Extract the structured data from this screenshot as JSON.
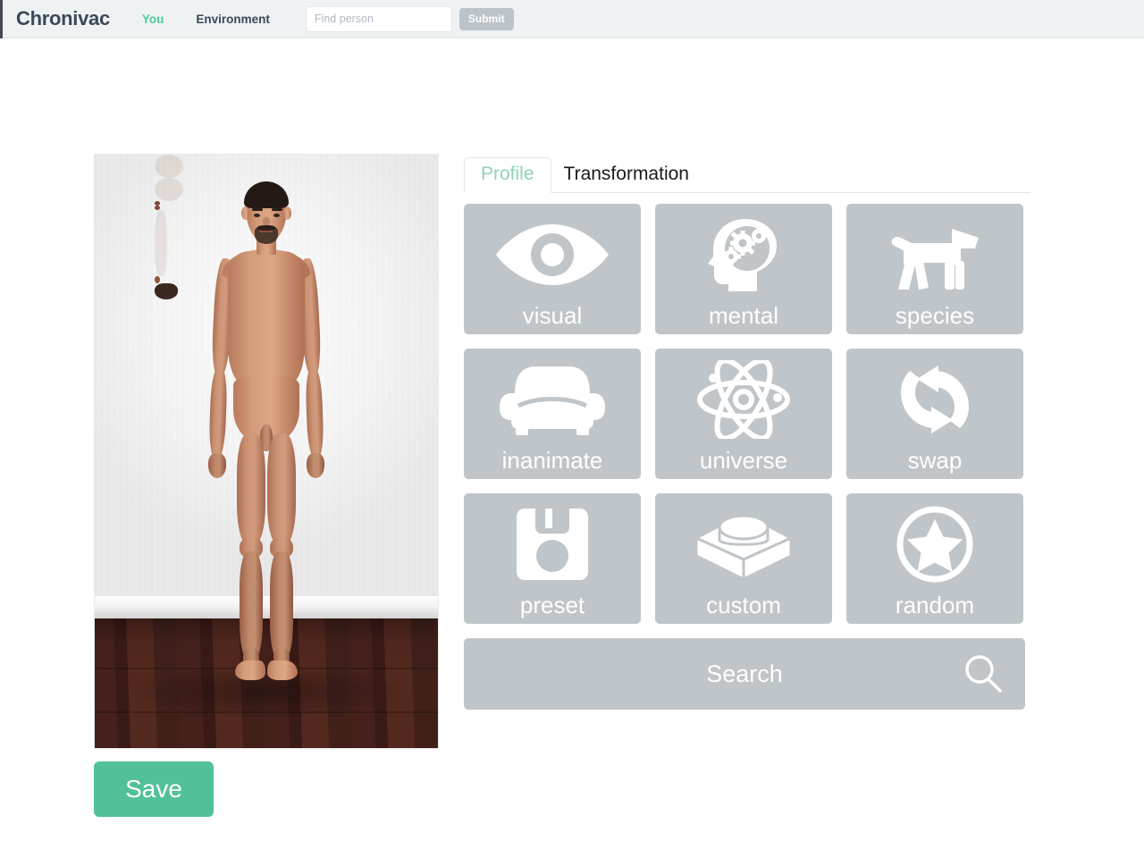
{
  "navbar": {
    "brand": "Chronivac",
    "links": [
      {
        "label": "You",
        "state": "active"
      },
      {
        "label": "Environment",
        "state": "default"
      }
    ],
    "search": {
      "value": "",
      "placeholder": "Find person"
    },
    "submit_label": "Submit",
    "colors": {
      "background": "#eef2f3",
      "brand_text": "#3c4858",
      "active_link": "#4ec998",
      "submit_button": "#bcc3c9"
    }
  },
  "profile_panel": {
    "photo_alt": "Full-body standing photo of a person against a white wall with dark wooden floor",
    "save_label": "Save",
    "save_color": "#52c198"
  },
  "tabs": [
    {
      "label": "Profile",
      "state": "inactive"
    },
    {
      "label": "Transformation",
      "state": "active"
    }
  ],
  "transformation": {
    "tile_color": "#bfc5c9",
    "tile_label_color": "#ffffff",
    "tiles": [
      {
        "label": "visual",
        "icon": "eye-icon"
      },
      {
        "label": "mental",
        "icon": "head-gears-icon"
      },
      {
        "label": "species",
        "icon": "dog-icon"
      },
      {
        "label": "inanimate",
        "icon": "armchair-icon"
      },
      {
        "label": "universe",
        "icon": "atom-icon"
      },
      {
        "label": "swap",
        "icon": "swap-arrows-icon"
      },
      {
        "label": "preset",
        "icon": "floppy-disk-icon"
      },
      {
        "label": "custom",
        "icon": "lego-brick-icon"
      },
      {
        "label": "random",
        "icon": "star-circle-icon"
      }
    ],
    "search": {
      "label": "Search",
      "icon": "magnifier-icon"
    }
  }
}
